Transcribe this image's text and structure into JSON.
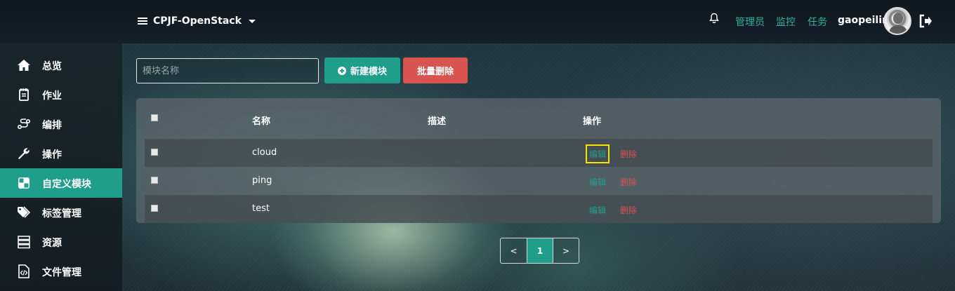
{
  "header": {
    "project_name": "CPJF-OpenStack",
    "nav_links": [
      "管理员",
      "监控",
      "任务"
    ],
    "username": "gaopeilin"
  },
  "sidebar": {
    "items": [
      {
        "label": "总览",
        "icon": "home-icon"
      },
      {
        "label": "作业",
        "icon": "notebook-icon"
      },
      {
        "label": "编排",
        "icon": "workflow-icon"
      },
      {
        "label": "操作",
        "icon": "wrench-icon"
      },
      {
        "label": "自定义模块",
        "icon": "module-icon",
        "active": true
      },
      {
        "label": "标签管理",
        "icon": "tags-icon"
      },
      {
        "label": "资源",
        "icon": "server-icon"
      },
      {
        "label": "文件管理",
        "icon": "code-file-icon"
      }
    ]
  },
  "toolbar": {
    "search_placeholder": "模块名称",
    "new_label": "新建模块",
    "batch_delete_label": "批量删除"
  },
  "table": {
    "columns": [
      "名称",
      "描述",
      "操作"
    ],
    "rows": [
      {
        "name": "cloud",
        "description": "",
        "edit": "编辑",
        "delete": "删除"
      },
      {
        "name": "ping",
        "description": "",
        "edit": "编辑",
        "delete": "删除"
      },
      {
        "name": "test",
        "description": "",
        "edit": "编辑",
        "delete": "删除"
      }
    ]
  },
  "pagination": {
    "prev": "<",
    "current": "1",
    "next": ">"
  },
  "colors": {
    "accent": "#1f9e8c",
    "danger": "#d9534f",
    "link": "#2bb3a0",
    "highlight": "#f5e600"
  }
}
